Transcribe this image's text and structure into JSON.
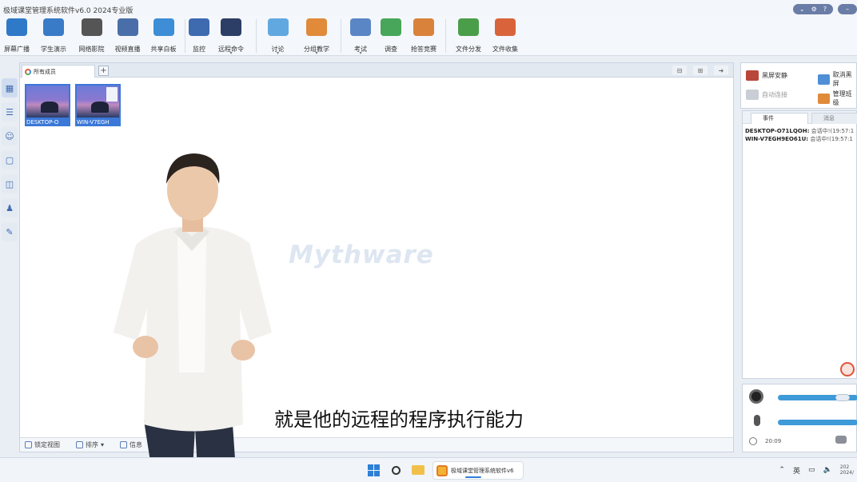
{
  "window": {
    "title": "极域课堂管理系统软件v6.0 2024专业版"
  },
  "toolbar": {
    "items": [
      {
        "label": "屏幕广播",
        "icon": "screen-broadcast-icon",
        "color": "#2f79c9"
      },
      {
        "label": "学生演示",
        "icon": "student-demo-icon",
        "color": "#3a7bc8"
      },
      {
        "label": "网络影院",
        "icon": "film-reel-icon",
        "color": "#555555"
      },
      {
        "label": "视频直播",
        "icon": "webcam-icon",
        "color": "#4a6fa8"
      },
      {
        "label": "共享白板",
        "icon": "whiteboard-icon",
        "color": "#3d8ed6"
      },
      {
        "label": "监控",
        "icon": "monitor-person-icon",
        "color": "#3e6ab0"
      },
      {
        "label": "远程命令",
        "icon": "remote-command-icon",
        "color": "#2c3e66"
      },
      {
        "label": "讨论",
        "icon": "discussion-icon",
        "color": "#62a8e0"
      },
      {
        "label": "分组教学",
        "icon": "group-teaching-icon",
        "color": "#e08a3a"
      },
      {
        "label": "考试",
        "icon": "exam-icon",
        "color": "#5a86c6"
      },
      {
        "label": "调查",
        "icon": "survey-icon",
        "color": "#47a65a"
      },
      {
        "label": "抢答竞赛",
        "icon": "quiz-contest-icon",
        "color": "#d9823b"
      },
      {
        "label": "文件分发",
        "icon": "file-distribute-icon",
        "color": "#4a9e4a"
      },
      {
        "label": "文件收集",
        "icon": "file-collect-icon",
        "color": "#d9643b"
      }
    ]
  },
  "tabs": {
    "active_label": "所有成员",
    "add_label": "+"
  },
  "students": [
    {
      "name": "DESKTOP-O"
    },
    {
      "name": "WIN-V7EGH"
    }
  ],
  "watermark": "Mythware",
  "status": {
    "lock_view": "锁定视图",
    "sort": "排序",
    "info": "信息"
  },
  "right_panel": {
    "screen_lock": "黑屏安静",
    "cancel_screen": "取消黑屏",
    "auto_connect": "自动连接",
    "manage": "管理班级"
  },
  "events": {
    "tab_events": "事件",
    "tab_messages": "消息",
    "lines": [
      {
        "host": "DESKTOP-O71LQOH:",
        "text": "会话中!(19:57:1"
      },
      {
        "host": "WIN-V7EGH9EO61U:",
        "text": "会话中!(19:57:1"
      }
    ]
  },
  "audio": {
    "time": "20:09"
  },
  "subtitle": "就是他的远程的程序执行能力",
  "taskbar": {
    "active_app": "极域课堂管理系统软件v6",
    "ime": "英",
    "date_top": "202",
    "date_bottom": "2024/"
  }
}
